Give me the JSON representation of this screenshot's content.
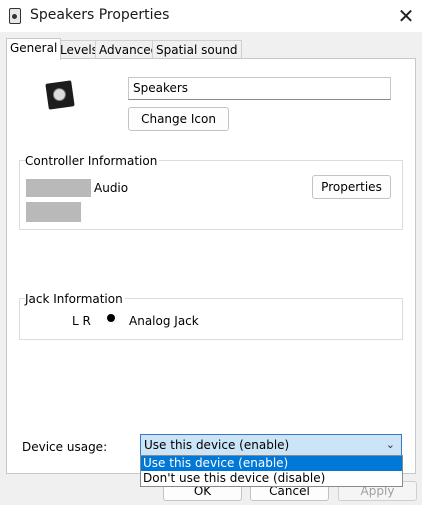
{
  "window": {
    "title": "Speakers Properties",
    "close_glyph": "✕"
  },
  "tabs": [
    {
      "label": "General",
      "active": true
    },
    {
      "label": "Levels",
      "active": false
    },
    {
      "label": "Advanced",
      "active": false
    },
    {
      "label": "Spatial sound",
      "active": false
    }
  ],
  "general": {
    "device_name_value": "Speakers",
    "change_icon_label": "Change Icon",
    "controller_info_label": "Controller Information",
    "controller_name_suffix": "Audio",
    "properties_label": "Properties",
    "jack_info_label": "Jack Information",
    "jack_channels": "L R",
    "jack_type": "Analog Jack",
    "jack_dot_color": "#000000",
    "device_usage_label": "Device usage:",
    "device_usage_selected": "Use this device (enable)",
    "device_usage_options": [
      "Use this device (enable)",
      "Don't use this device (disable)"
    ]
  },
  "footer": {
    "ok_label": "OK",
    "cancel_label": "Cancel",
    "apply_label": "Apply"
  },
  "icons": {
    "speaker": "speaker-icon",
    "dropdown": "chevron-down-icon",
    "close": "close-icon"
  },
  "colors": {
    "selection": "#0078d7",
    "select_bg": "#cce4f7",
    "select_border": "#3b78c4"
  }
}
